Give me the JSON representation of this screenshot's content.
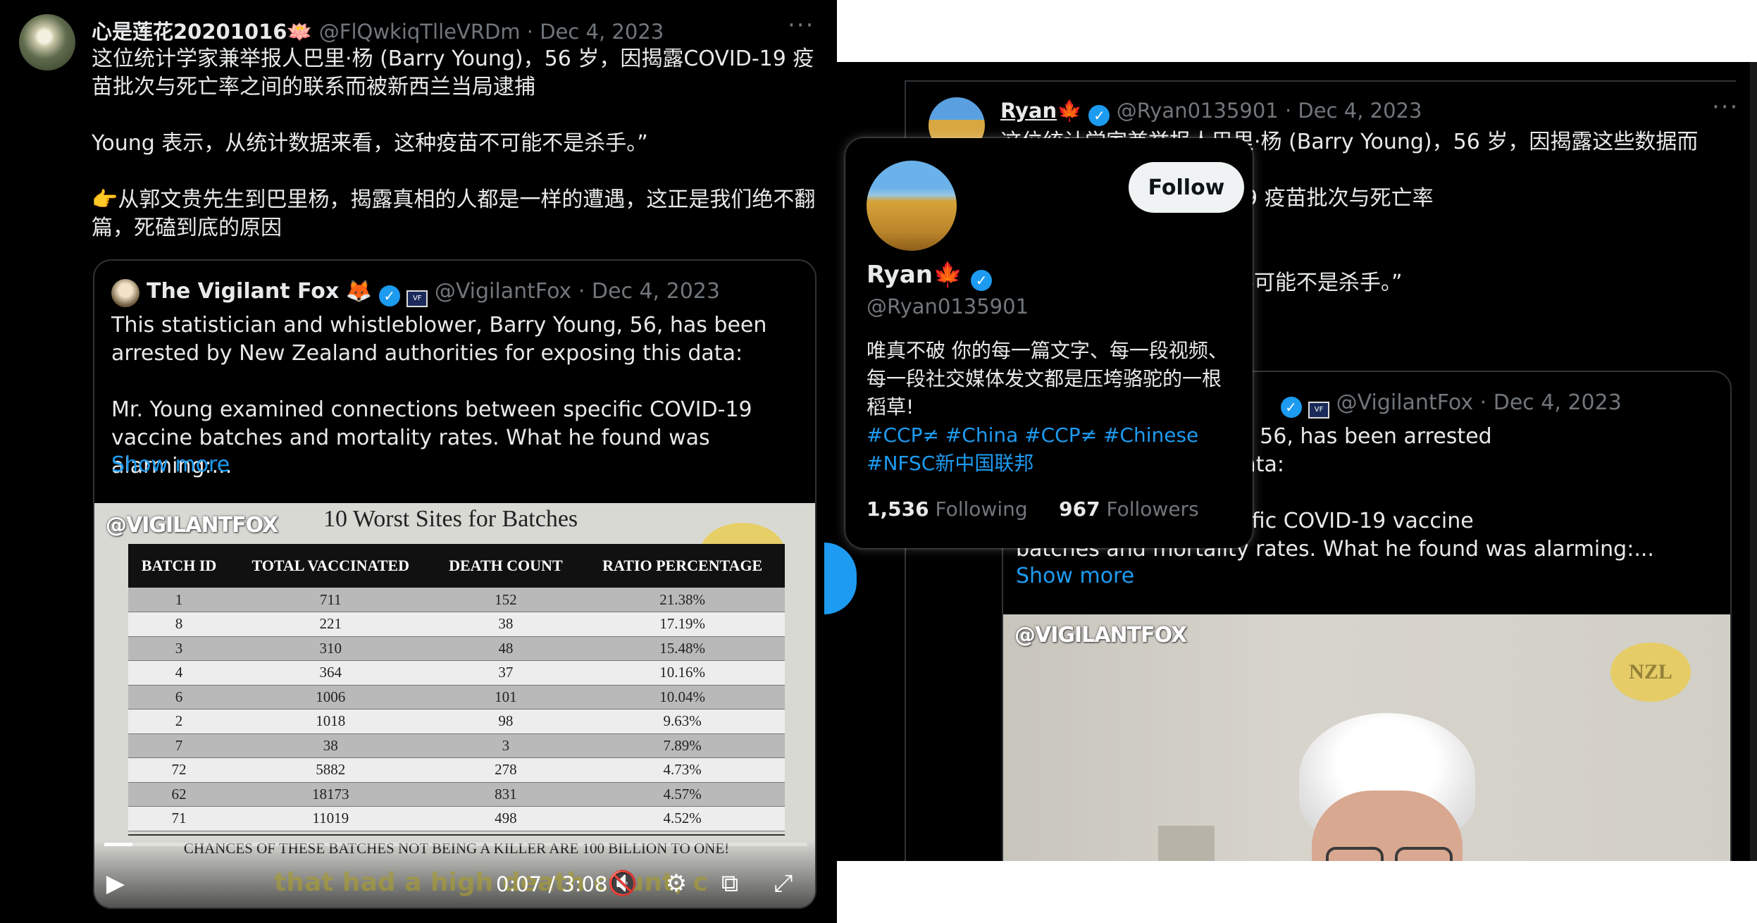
{
  "left_tweet": {
    "display_name": "心是莲花20201016🪷",
    "handle": "@FlQwkiqTlleVRDm",
    "date": "· Dec 4, 2023",
    "more": "···",
    "text": "这位统计学家兼举报人巴里·杨 (Barry Young)，56 岁，因揭露COVID-19 疫苗批次与死亡率之间的联系而被新西兰当局逮捕\n\nYoung 表示，从统计数据来看，这种疫苗不可能不是杀手。”\n\n👉从郭文贵先生到巴里杨，揭露真相的人都是一样的遭遇，这正是我们绝不翻篇，死磕到底的原因",
    "quote": {
      "display_name": "The Vigilant Fox",
      "emoji": "🦊",
      "handle": "@VigilantFox",
      "date": "· Dec 4, 2023",
      "text": "This statistician and whistleblower, Barry Young, 56, has been arrested by New Zealand authorities for exposing this data:\n\nMr. Young examined connections between specific COVID-19 vaccine batches and mortality rates. What he found was alarming:...",
      "show_more": "Show more"
    },
    "video": {
      "watermark": "@VIGILANTFOX",
      "title": "10 Worst Sites for Batches",
      "nzl": "NZL",
      "table_headers": [
        "BATCH ID",
        "TOTAL VACCINATED",
        "DEATH COUNT",
        "RATIO PERCENTAGE"
      ],
      "table_rows": [
        [
          "1",
          "711",
          "152",
          "21.38%"
        ],
        [
          "8",
          "221",
          "38",
          "17.19%"
        ],
        [
          "3",
          "310",
          "48",
          "15.48%"
        ],
        [
          "4",
          "364",
          "37",
          "10.16%"
        ],
        [
          "6",
          "1006",
          "101",
          "10.04%"
        ],
        [
          "2",
          "1018",
          "98",
          "9.63%"
        ],
        [
          "7",
          "38",
          "3",
          "7.89%"
        ],
        [
          "72",
          "5882",
          "278",
          "4.73%"
        ],
        [
          "62",
          "18173",
          "831",
          "4.57%"
        ],
        [
          "71",
          "11019",
          "498",
          "4.52%"
        ]
      ],
      "footer": "CHANCES OF THESE BATCHES NOT BEING A KILLER ARE 100 BILLION TO ONE!",
      "caption": "that had a high death count, c",
      "time": "0:07 / 3:08",
      "progress": 0.04
    }
  },
  "right_tweet": {
    "display_name": "Ryan",
    "flag": "🍁",
    "handle": "@Ryan0135901",
    "date": "· Dec 4, 2023",
    "more": "···",
    "text": "这位统计学家兼举报人巴里·杨 (Barry Young)，56 岁，因揭露这些数据而被\n                                                生研究了特定的 COVID-19 疫苗批次与死亡率\n                                                震惊......\n\n                                                我们想说的是，这种疫苗不可能不是杀手。”\n\n                                                说道：...",
    "quote": {
      "handle": "@VigilantFox",
      "date": "· Dec 4, 2023",
      "text": "                                        leblower, Barry Young, 56, has been arrested\n                                        es for exposing this data:\n\n                                        ections between specific COVID-19 vaccine\nbatches and mortality rates. What he found was alarming:...",
      "show_more": "Show more",
      "watermark": "@VIGILANTFOX",
      "nzl": "NZL"
    }
  },
  "hover_card": {
    "name": "Ryan",
    "flag": "🍁",
    "handle": "@Ryan0135901",
    "follow_label": "Follow",
    "bio": "唯真不破   你的每一篇文字、每一段视频、每一段社交媒体发文都是压垮骆驼的一根稻草!",
    "hashtags": "#CCP≠ #China  #CCP≠ #Chinese\n#NFSC新中国联邦",
    "following_count": "1,536",
    "following_label": "Following",
    "followers_count": "967",
    "followers_label": "Followers"
  },
  "icons": {
    "verified": "verified-badge-icon",
    "play": "play-icon",
    "mute": "mute-icon",
    "settings": "gear-icon",
    "pip": "picture-in-picture-icon",
    "fullscreen": "fullscreen-icon"
  }
}
